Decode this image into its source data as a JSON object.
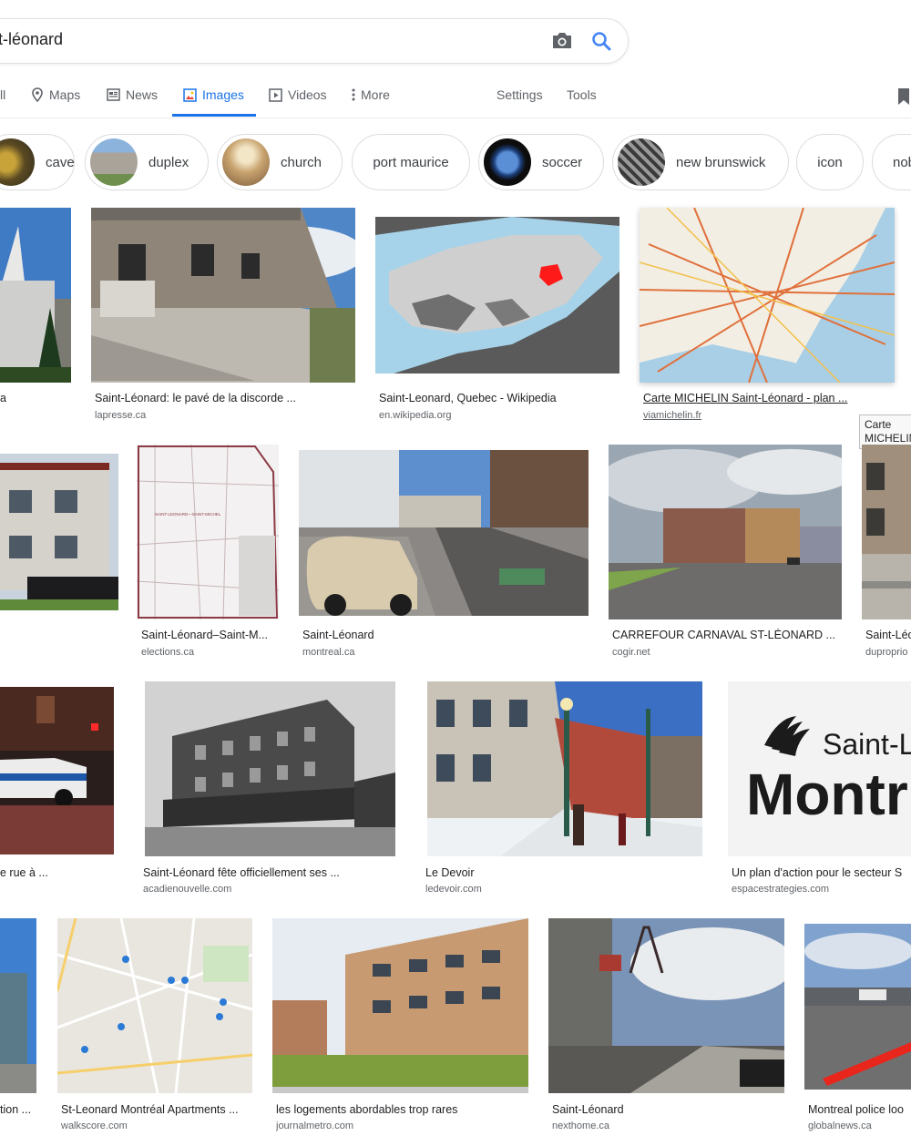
{
  "search": {
    "query": "t-léonard"
  },
  "tabs": [
    {
      "label": "ll"
    },
    {
      "label": "Maps"
    },
    {
      "label": "News"
    },
    {
      "label": "Images"
    },
    {
      "label": "Videos"
    },
    {
      "label": "More"
    },
    {
      "label": "Settings"
    },
    {
      "label": "Tools"
    }
  ],
  "chips": [
    {
      "label": "cave"
    },
    {
      "label": "duplex"
    },
    {
      "label": "church"
    },
    {
      "label": "port maurice"
    },
    {
      "label": "soccer"
    },
    {
      "label": "new brunswick"
    },
    {
      "label": "icon"
    },
    {
      "label": "nob"
    }
  ],
  "results": [
    {
      "title": "a",
      "source": ""
    },
    {
      "title": "Saint-Léonard: le pavé de la discorde ...",
      "source": "lapresse.ca"
    },
    {
      "title": "Saint-Leonard, Quebec - Wikipedia",
      "source": "en.wikipedia.org"
    },
    {
      "title": "Carte MICHELIN Saint-Léonard - plan ...",
      "source": "viamichelin.fr"
    },
    {
      "title": "",
      "source": ""
    },
    {
      "title": "Saint-Léonard–Saint-M...",
      "source": "elections.ca"
    },
    {
      "title": "Saint-Léonard",
      "source": "montreal.ca"
    },
    {
      "title": "CARREFOUR CARNAVAL ST-LÉONARD ...",
      "source": "cogir.net"
    },
    {
      "title": "Saint-Léo",
      "source": "duproprio"
    },
    {
      "title": "e rue à ...",
      "source": ""
    },
    {
      "title": "Saint-Léonard fête officiellement ses ...",
      "source": "acadienouvelle.com"
    },
    {
      "title": "Le Devoir",
      "source": "ledevoir.com"
    },
    {
      "title": "Un plan d'action pour le secteur S",
      "source": "espacestrategies.com"
    },
    {
      "title": "tion ...",
      "source": ""
    },
    {
      "title": "St-Leonard Montréal Apartments ...",
      "source": "walkscore.com"
    },
    {
      "title": "les logements abordables trop rares",
      "source": "journalmetro.com"
    },
    {
      "title": "Saint-Léonard",
      "source": "nexthome.ca"
    },
    {
      "title": "Montreal police loo",
      "source": "globalnews.ca"
    }
  ],
  "tooltip": {
    "text": "Carte MICHELIN Saint-Léonard -"
  },
  "image_text": {
    "map_title": "SAINT-LEONARD—SAINT-MICHEL",
    "logo_line1": "Saint-L",
    "logo_line2": "Montr"
  },
  "colors": {
    "accent": "#1a73e8",
    "map_highlight": "#ff1a1a",
    "water": "#a6d3ea"
  }
}
